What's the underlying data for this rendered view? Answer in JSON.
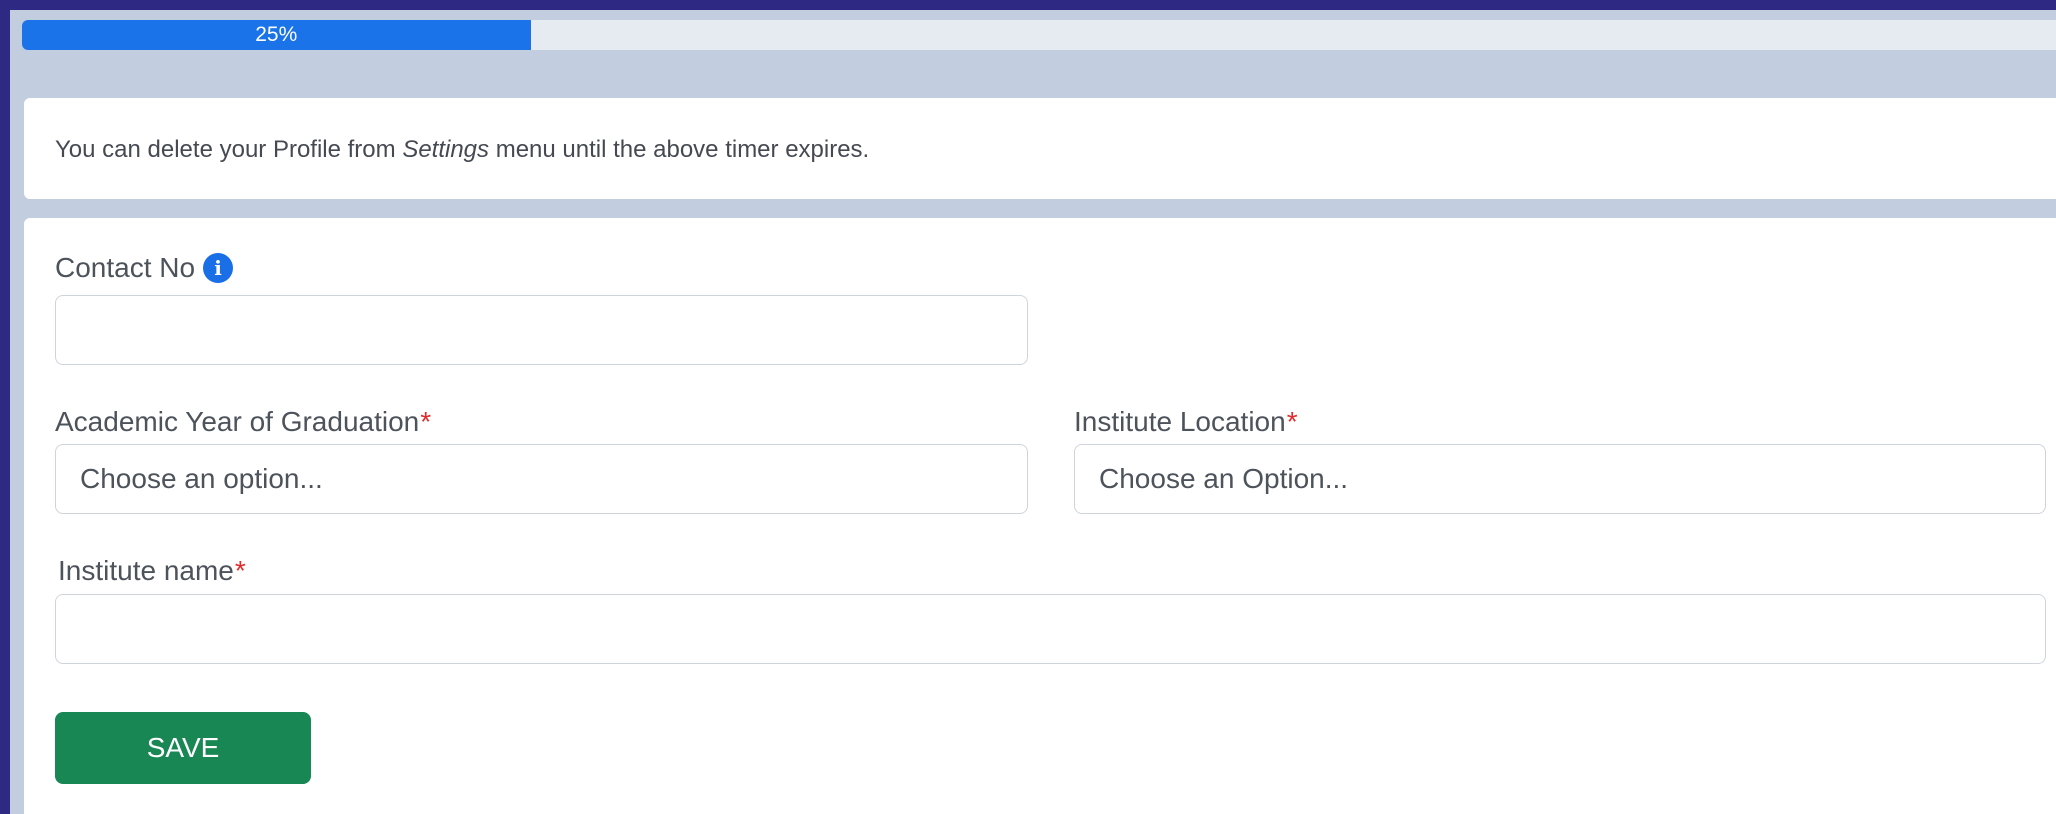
{
  "progress": {
    "value_percent": 25,
    "label": "25%",
    "color": "#1a73e8"
  },
  "notice": {
    "prefix": "You can delete your Profile from ",
    "emphasis": "Settings",
    "suffix": " menu until the above timer expires."
  },
  "form": {
    "contact": {
      "label": "Contact No",
      "icon": "info-icon",
      "value": ""
    },
    "graduation_year": {
      "label": "Academic Year of Graduation",
      "required_mark": "*",
      "placeholder": "Choose an option..."
    },
    "institute_location": {
      "label": "Institute Location",
      "required_mark": "*",
      "placeholder": "Choose an Option..."
    },
    "institute_name": {
      "label": "Institute name",
      "required_mark": "*",
      "value": ""
    },
    "save_label": "SAVE",
    "save_color": "#198754"
  }
}
